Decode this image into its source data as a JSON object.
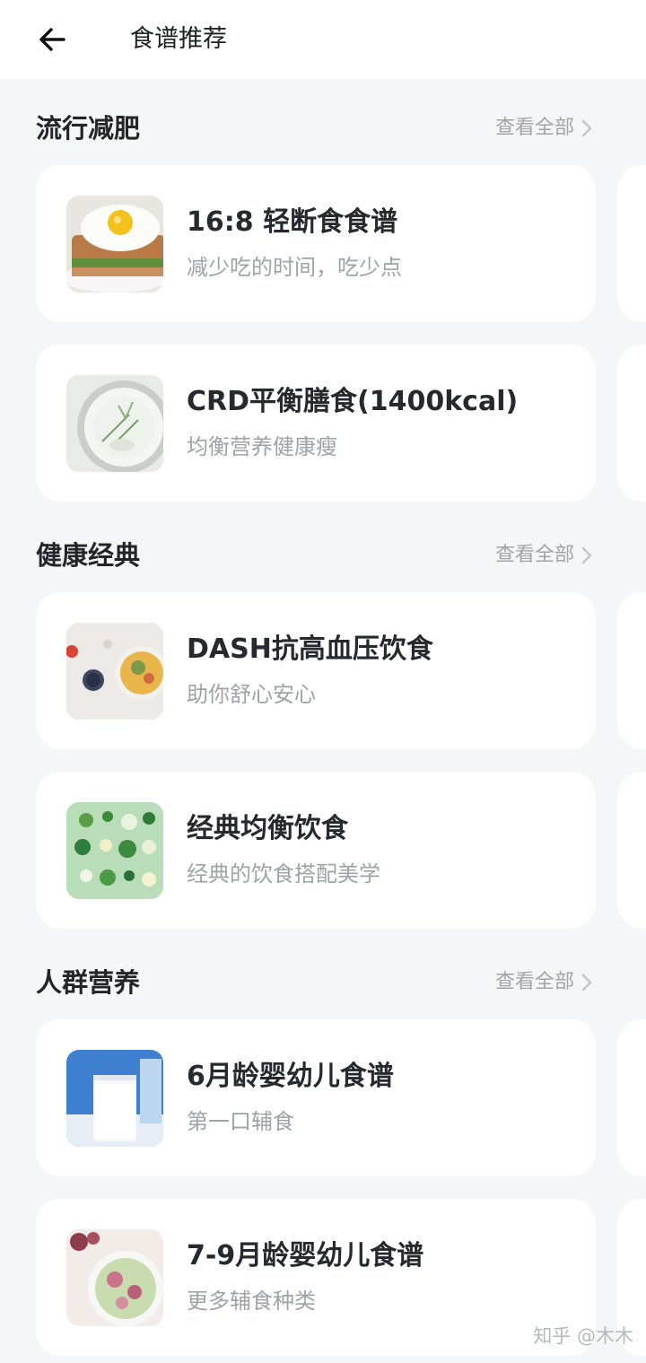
{
  "header": {
    "title": "食谱推荐"
  },
  "sections": [
    {
      "title": "流行减肥",
      "view_all": "查看全部",
      "cards": [
        {
          "title": "16:8 轻断食食谱",
          "subtitle": "减少吃的时间，吃少点",
          "image": "egg-toast"
        },
        {
          "title": "CRD平衡膳食(1400kcal)",
          "subtitle": "均衡营养健康瘦",
          "image": "yogurt-bowl"
        }
      ]
    },
    {
      "title": "健康经典",
      "view_all": "查看全部",
      "cards": [
        {
          "title": "DASH抗高血压饮食",
          "subtitle": "助你舒心安心",
          "image": "grain-bowl"
        },
        {
          "title": "经典均衡饮食",
          "subtitle": "经典的饮食搭配美学",
          "image": "vegetables"
        }
      ]
    },
    {
      "title": "人群营养",
      "view_all": "查看全部",
      "cards": [
        {
          "title": "6月龄婴幼儿食谱",
          "subtitle": "第一口辅食",
          "image": "milk-glass"
        },
        {
          "title": "7-9月龄婴幼儿食谱",
          "subtitle": "更多辅食种类",
          "image": "fig-puree"
        }
      ]
    }
  ],
  "watermark": "知乎 @木木"
}
